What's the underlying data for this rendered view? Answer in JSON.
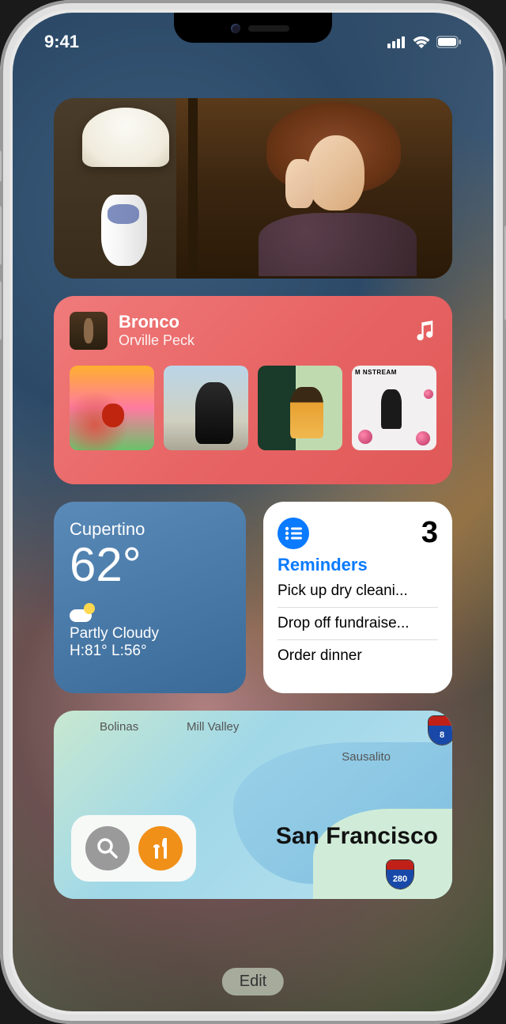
{
  "status": {
    "time": "9:41"
  },
  "music": {
    "title": "Bronco",
    "artist": "Orville Peck"
  },
  "weather": {
    "city": "Cupertino",
    "temp": "62°",
    "condition": "Partly Cloudy",
    "highlow": "H:81° L:56°"
  },
  "reminders": {
    "title": "Reminders",
    "count": "3",
    "items": [
      "Pick up dry cleani...",
      "Drop off fundraise...",
      "Order dinner"
    ]
  },
  "maps": {
    "labels": [
      "Bolinas",
      "Mill Valley",
      "Sausalito"
    ],
    "city": "San Francisco",
    "shields": [
      "8",
      "280"
    ]
  },
  "edit": "Edit"
}
